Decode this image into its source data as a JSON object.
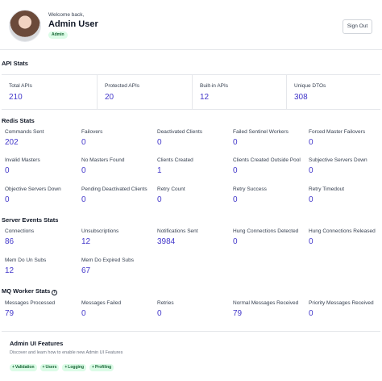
{
  "header": {
    "welcome": "Welcome back,",
    "username": "Admin User",
    "role": "Admin",
    "signout_label": "Sign Out"
  },
  "api_stats": {
    "title": "API Stats",
    "items": [
      {
        "label": "Total APIs",
        "value": "210"
      },
      {
        "label": "Protected APIs",
        "value": "20"
      },
      {
        "label": "Built-in APIs",
        "value": "12"
      },
      {
        "label": "Unique DTOs",
        "value": "308"
      }
    ]
  },
  "redis_stats": {
    "title": "Redis Stats",
    "items": [
      {
        "label": "Commands Sent",
        "value": "202"
      },
      {
        "label": "Failovers",
        "value": "0"
      },
      {
        "label": "Deactivated Clients",
        "value": "0"
      },
      {
        "label": "Failed Sentinel Workers",
        "value": "0"
      },
      {
        "label": "Forced Master Failovers",
        "value": "0"
      },
      {
        "label": "Invalid Masters",
        "value": "0"
      },
      {
        "label": "No Masters Found",
        "value": "0"
      },
      {
        "label": "Clients Created",
        "value": "1"
      },
      {
        "label": "Clients Created Outside Pool",
        "value": "0"
      },
      {
        "label": "Subjective Servers Down",
        "value": "0"
      },
      {
        "label": "Objective Servers Down",
        "value": "0"
      },
      {
        "label": "Pending Deactivated Clients",
        "value": "0"
      },
      {
        "label": "Retry Count",
        "value": "0"
      },
      {
        "label": "Retry Success",
        "value": "0"
      },
      {
        "label": "Retry Timedout",
        "value": "0"
      }
    ]
  },
  "server_events": {
    "title": "Server Events Stats",
    "items": [
      {
        "label": "Connections",
        "value": "86"
      },
      {
        "label": "Unsubscriptions",
        "value": "12"
      },
      {
        "label": "Notifications Sent",
        "value": "3984"
      },
      {
        "label": "Hung Connections Detected",
        "value": "0"
      },
      {
        "label": "Hung Connections Released",
        "value": "0"
      },
      {
        "label": "Mem Do Un Subs",
        "value": "12"
      },
      {
        "label": "Mem Do Expired Subs",
        "value": "67"
      }
    ]
  },
  "mq_worker": {
    "title": "MQ Worker Stats",
    "info_icon": "i",
    "items": [
      {
        "label": "Messages Processed",
        "value": "79"
      },
      {
        "label": "Messages Failed",
        "value": "0"
      },
      {
        "label": "Retries",
        "value": "0"
      },
      {
        "label": "Normal Messages Received",
        "value": "79"
      },
      {
        "label": "Priority Messages Received",
        "value": "0"
      }
    ]
  },
  "features": {
    "title": "Admin UI Features",
    "description": "Discover and learn how to enable new Admin UI Features",
    "plus": "+",
    "chips": [
      "Validation",
      "Users",
      "Logging",
      "Profiling"
    ]
  }
}
